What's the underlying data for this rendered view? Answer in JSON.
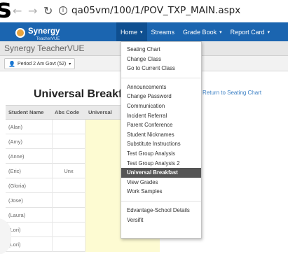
{
  "browser": {
    "corner_mark": "s",
    "back_icon": "back-arrow-icon",
    "forward_icon": "forward-arrow-icon",
    "reload_icon": "reload-icon",
    "url": "qa05vm/100/1/POV_TXP_MAIN.aspx"
  },
  "navbar": {
    "logo_text": "Synergy",
    "logo_sub": "TeacherVUE",
    "items": [
      {
        "label": "Home"
      },
      {
        "label": "Streams"
      },
      {
        "label": "Grade Book"
      },
      {
        "label": "Report Card"
      }
    ]
  },
  "app": {
    "title": "Synergy TeacherVUE",
    "period_label": "Period 2 Am Govt (52)"
  },
  "page": {
    "title": "Universal Breakfast",
    "return_link": "Return to Seating Chart"
  },
  "table": {
    "columns": [
      "Student Name",
      "Abs Code",
      "Universal"
    ],
    "rows": [
      {
        "name": "(Alan)",
        "abs": ""
      },
      {
        "name": "(Amy)",
        "abs": ""
      },
      {
        "name": "(Anne)",
        "abs": ""
      },
      {
        "name": "(Eric)",
        "abs": "Unx"
      },
      {
        "name": "(Gloria)",
        "abs": ""
      },
      {
        "name": "(Jose)",
        "abs": ""
      },
      {
        "name": "(Laura)",
        "abs": ""
      },
      {
        "name": "(Lori)",
        "abs": ""
      },
      {
        "name": "(Lori)",
        "abs": ""
      }
    ]
  },
  "menu": {
    "group1": [
      "Seating Chart",
      "Change Class",
      "Go to Current Class"
    ],
    "group2": [
      "Announcements",
      "Change Password",
      "Communication",
      "Incident Referral",
      "Parent Conference",
      "Student Nicknames",
      "Substitute Instructions",
      "Test Group Analysis",
      "Test Group Analysis 2",
      "Universal Breakfast",
      "View Grades",
      "Work Samples"
    ],
    "group3": [
      "Edvantage-School Details",
      "Versifit"
    ],
    "selected": "Universal Breakfast"
  },
  "colors": {
    "navbar": "#1b65b0",
    "highlight_column": "#fdfbd2",
    "selected_menu": "#555555",
    "link": "#3a7fc4"
  }
}
